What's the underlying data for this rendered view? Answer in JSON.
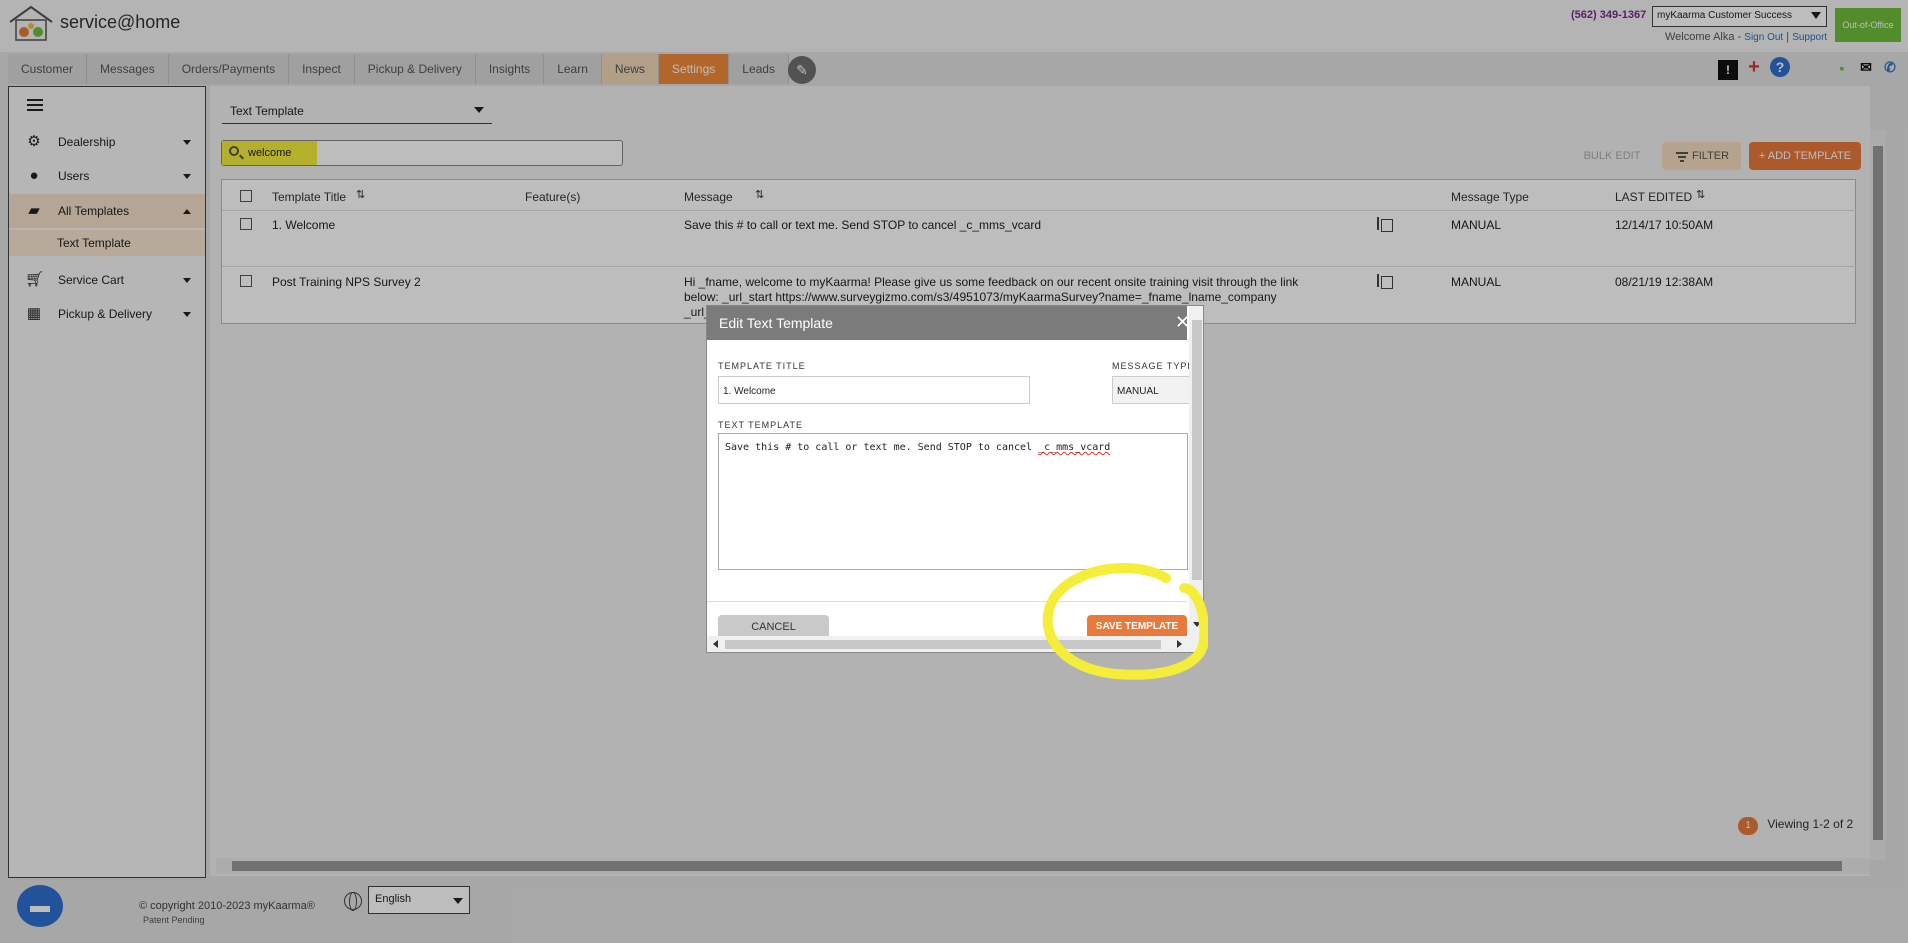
{
  "header": {
    "brand": "service@home",
    "phone": "(562) 349-1367",
    "account": "myKaarma Customer Success",
    "out_of_office": "Out-of-Office",
    "welcome": "Welcome Alka -",
    "sign_out": "Sign Out",
    "separator": "|",
    "support": "Support"
  },
  "nav": {
    "tabs": [
      "Customer",
      "Messages",
      "Orders/Payments",
      "Inspect",
      "Pickup & Delivery",
      "Insights",
      "Learn",
      "News",
      "Settings",
      "Leads"
    ]
  },
  "sidebar": {
    "items": [
      {
        "label": "Dealership",
        "icon": "gear-icon"
      },
      {
        "label": "Users",
        "icon": "user-icon"
      },
      {
        "label": "All Templates",
        "icon": "chat-icon"
      },
      {
        "label": "Service Cart",
        "icon": "cart-icon"
      },
      {
        "label": "Pickup & Delivery",
        "icon": "calendar-icon"
      }
    ],
    "sub_item": "Text Template"
  },
  "main": {
    "template_type": "Text Template",
    "search_value": "welcome",
    "bulk_edit": "BULK EDIT",
    "filter": "FILTER",
    "add_template": "+ ADD TEMPLATE",
    "columns": {
      "title": "Template Title",
      "features": "Feature(s)",
      "message": "Message",
      "message_type": "Message Type",
      "last_edited": "LAST EDITED"
    },
    "rows": [
      {
        "title": "1. Welcome",
        "message_1": "Save this # to call or text me. Send STOP to cancel _c_mms_vcard",
        "message_2": "",
        "message_3": "",
        "type": "MANUAL",
        "edited": "12/14/17 10:50AM"
      },
      {
        "title": "Post Training NPS Survey 2",
        "message_1": "Hi _fname, welcome to myKaarma! Please give us some feedback on our recent onsite training visit through the link",
        "message_2": "below: _url_start https://www.surveygizmo.com/s3/4951073/myKaarmaSurvey?name=_fname_lname_company",
        "message_3": "_url_e",
        "type": "MANUAL",
        "edited": "08/21/19 12:38AM"
      }
    ],
    "pager_badge": "1",
    "pager_text": "Viewing 1-2 of 2"
  },
  "footer": {
    "copyright": "© copyright 2010-2023 myKaarma®",
    "patent": "Patent Pending",
    "language": "English"
  },
  "modal": {
    "title": "Edit Text Template",
    "template_title_label": "TEMPLATE TITLE",
    "template_title_value": "1. Welcome",
    "message_type_label": "MESSAGE TYPE",
    "message_type_value": "MANUAL",
    "text_template_label": "TEXT TEMPLATE",
    "text_template_value": "Save this # to call or text me. Send STOP to cancel ",
    "text_template_token": "_c_mms_vcard",
    "cancel": "CANCEL",
    "save": "SAVE TEMPLATE"
  },
  "colors": {
    "accent_orange": "#e8793a",
    "highlight_yellow": "#f4ee3a",
    "ooo_green": "#6fbf3b",
    "chat_blue": "#2f6fd0"
  }
}
